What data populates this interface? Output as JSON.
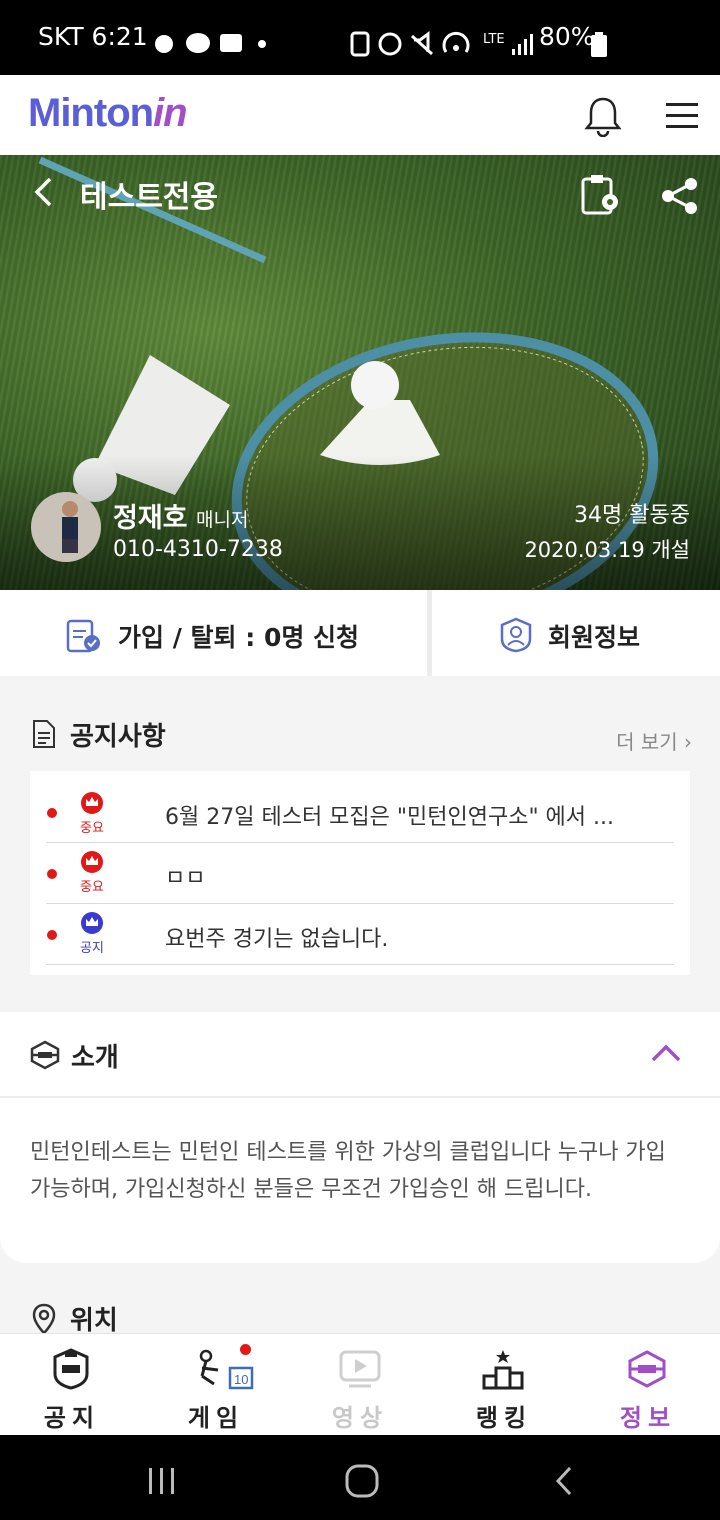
{
  "status_bar": {
    "carrier_time": "SKT 6:21",
    "network": "LTE",
    "battery": "80%"
  },
  "app": {
    "logo_main": "Minton",
    "logo_in": "in"
  },
  "club": {
    "name": "테스트전용",
    "manager_name": "정재호",
    "manager_role": "매니저",
    "phone": "010-4310-7238",
    "active_members": "34명 활동중",
    "opened": "2020.03.19 개설"
  },
  "actions": {
    "join_leave": "가입 / 탈퇴 : 0명 신청",
    "member_info": "회원정보"
  },
  "notices": {
    "title": "공지사항",
    "more": "더 보기 ›",
    "items": [
      {
        "badge": "중요",
        "text": "6월 27일 테스터 모집은 \"민턴인연구소\" 에서 ..."
      },
      {
        "badge": "중요",
        "text": "ㅁㅁ"
      },
      {
        "badge": "공지",
        "text": "요번주 경기는 없습니다."
      }
    ]
  },
  "intro": {
    "title": "소개",
    "body": "민턴인테스트는 민턴인 테스트를 위한 가상의 클럽입니다 누구나 가입 가능하며, 가입신청하신 분들은 무조건 가입승인 해 드립니다."
  },
  "location": {
    "title": "위치"
  },
  "tabs": [
    {
      "label": "공지",
      "icon": "notice-shield-icon"
    },
    {
      "label": "게임",
      "icon": "game-icon"
    },
    {
      "label": "영상",
      "icon": "video-play-icon"
    },
    {
      "label": "랭킹",
      "icon": "ranking-podium-icon"
    },
    {
      "label": "정보",
      "icon": "info-shield-icon"
    }
  ],
  "colors": {
    "accent": "#a14fc8",
    "brand_blue": "#5b5fd6",
    "important_red": "#e01818",
    "notice_blue": "#3a3ad0"
  }
}
